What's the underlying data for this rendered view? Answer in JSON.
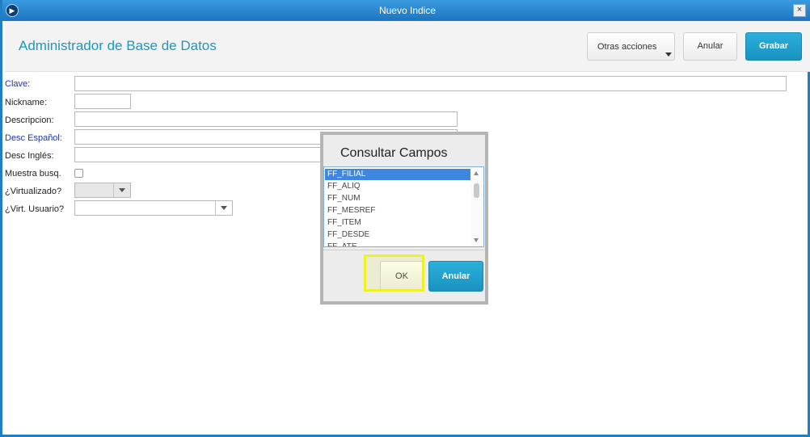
{
  "window": {
    "title": "Nuevo Indice",
    "close_symbol": "×"
  },
  "header": {
    "app_title": "Administrador de Base de Datos",
    "more_actions_label": "Otras acciones",
    "cancel_label": "Anular",
    "save_label": "Grabar"
  },
  "form": {
    "fields": [
      {
        "label": "Clave:",
        "value": ""
      },
      {
        "label": "Nickname:",
        "value": ""
      },
      {
        "label": "Descripcion:",
        "value": ""
      },
      {
        "label": "Desc Español:",
        "value": ""
      },
      {
        "label": "Desc Inglés:",
        "value": ""
      },
      {
        "label": "Muestra busq.",
        "checked": false
      },
      {
        "label": "¿Virtualizado?",
        "value": ""
      },
      {
        "label": "¿Virt. Usuario?",
        "value": ""
      }
    ]
  },
  "dialog": {
    "title": "Consultar Campos",
    "items": [
      "FF_FILIAL",
      "FF_ALIQ",
      "FF_NUM",
      "FF_MESREF",
      "FF_ITEM",
      "FF_DESDE",
      "FF_ATE"
    ],
    "selected_index": 0,
    "ok_label": "OK",
    "cancel_label": "Anular"
  },
  "colors": {
    "titlebar": "#1d74c0",
    "accent": "#1b97c2",
    "required_label": "#1a35b5",
    "highlight": "#eef02a"
  }
}
